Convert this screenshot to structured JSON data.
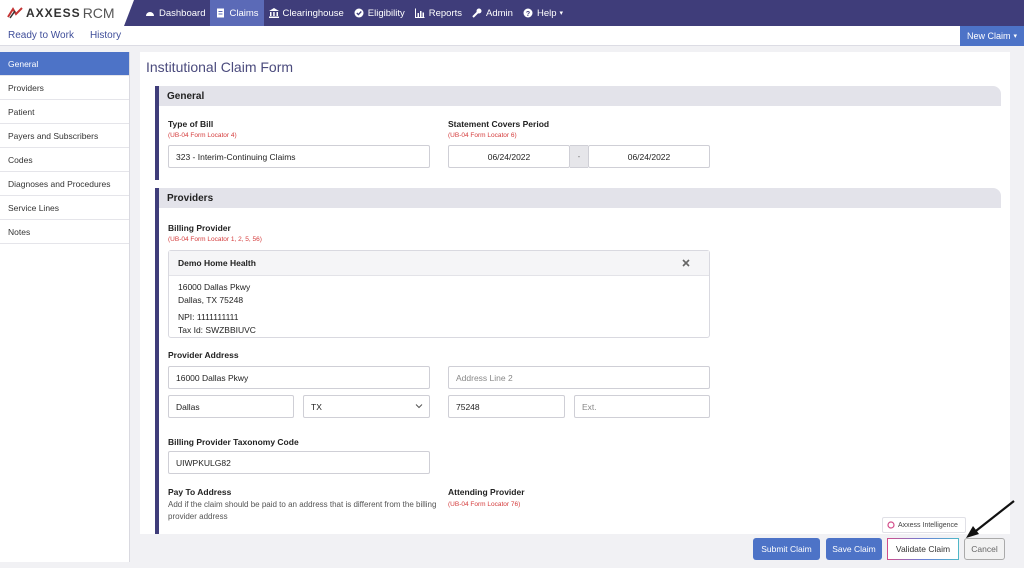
{
  "app": {
    "logo_text": "AXXESS",
    "logo_suffix": "RCM"
  },
  "nav": [
    {
      "label": "Dashboard",
      "icon": "dashboard-icon",
      "active": false
    },
    {
      "label": "Claims",
      "icon": "document-icon",
      "active": true
    },
    {
      "label": "Clearinghouse",
      "icon": "bank-icon",
      "active": false
    },
    {
      "label": "Eligibility",
      "icon": "check-circle-icon",
      "active": false
    },
    {
      "label": "Reports",
      "icon": "bar-chart-icon",
      "active": false
    },
    {
      "label": "Admin",
      "icon": "wrench-icon",
      "active": false
    },
    {
      "label": "Help",
      "icon": "question-icon",
      "active": false
    }
  ],
  "subnav": {
    "tabs": [
      "Ready to Work",
      "History"
    ],
    "new_claim_label": "New Claim"
  },
  "sidebar": {
    "items": [
      "General",
      "Providers",
      "Patient",
      "Payers and Subscribers",
      "Codes",
      "Diagnoses and Procedures",
      "Service Lines",
      "Notes"
    ],
    "active_index": 0
  },
  "form": {
    "title": "Institutional Claim Form",
    "general": {
      "heading": "General",
      "type_of_bill_label": "Type of Bill",
      "type_of_bill_locator": "(UB-04 Form Locator 4)",
      "type_of_bill_value": "323 - Interim-Continuing Claims",
      "statement_label": "Statement Covers Period",
      "statement_locator": "(UB-04 Form Locator 6)",
      "statement_from": "06/24/2022",
      "statement_sep": "-",
      "statement_to": "06/24/2022"
    },
    "providers": {
      "heading": "Providers",
      "billing_provider_label": "Billing Provider",
      "billing_provider_locator": "(UB-04 Form Locator 1, 2, 5, 56)",
      "card": {
        "name": "Demo Home Health",
        "address1": "16000 Dallas Pkwy",
        "address2": "Dallas, TX 75248",
        "npi": "NPI: 1111111111",
        "tax_id": "Tax Id: SWZBBIUVC"
      },
      "provider_address_label": "Provider Address",
      "address_line1": "16000 Dallas Pkwy",
      "address_line2_placeholder": "Address Line 2",
      "city": "Dallas",
      "state": "TX",
      "zip": "75248",
      "ext_placeholder": "Ext.",
      "taxonomy_label": "Billing Provider Taxonomy Code",
      "taxonomy_value": "UIWPKULG82",
      "pay_to_label": "Pay To Address",
      "pay_to_note": "Add if the claim should be paid to an address that is different from the billing provider address",
      "attending_label": "Attending Provider",
      "attending_locator": "(UB-04 Form Locator 76)"
    }
  },
  "footer": {
    "submit_label": "Submit Claim",
    "save_label": "Save Claim",
    "validate_label": "Validate Claim",
    "cancel_label": "Cancel",
    "ai_badge_label": "Axxess Intelligence"
  },
  "colors": {
    "nav_bg": "#3f3d7a",
    "accent": "#4d73c7",
    "locator_red": "#d43b3b"
  }
}
